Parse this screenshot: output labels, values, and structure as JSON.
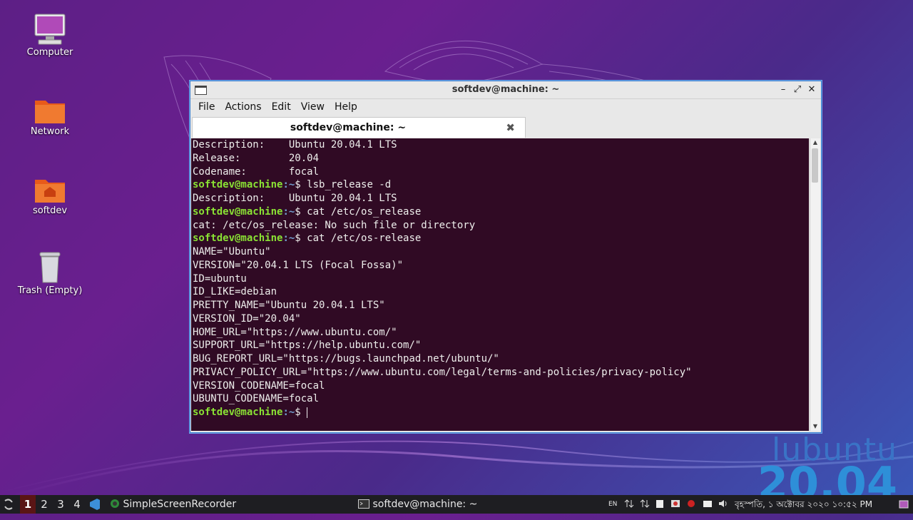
{
  "desktop": {
    "icons": [
      {
        "label": "Computer"
      },
      {
        "label": "Network"
      },
      {
        "label": "softdev"
      },
      {
        "label": "Trash (Empty)"
      }
    ],
    "brand": {
      "name": "lubuntu",
      "version": "20.04"
    }
  },
  "window": {
    "title": "softdev@machine: ~",
    "buttons": {
      "minimize": "–",
      "maximize": "⤢",
      "close": "✕"
    },
    "menu": [
      "File",
      "Actions",
      "Edit",
      "View",
      "Help"
    ],
    "tab": {
      "label": "softdev@machine: ~",
      "close": "✖"
    }
  },
  "terminal": {
    "prompt_user": "softdev@machine",
    "prompt_path": ":~",
    "prompt_symbol": "$ ",
    "lines": [
      {
        "type": "out",
        "text": "Description:    Ubuntu 20.04.1 LTS"
      },
      {
        "type": "out",
        "text": "Release:        20.04"
      },
      {
        "type": "out",
        "text": "Codename:       focal"
      },
      {
        "type": "cmd",
        "text": "lsb_release -d"
      },
      {
        "type": "out",
        "text": "Description:    Ubuntu 20.04.1 LTS"
      },
      {
        "type": "cmd",
        "text": "cat /etc/os_release"
      },
      {
        "type": "out",
        "text": "cat: /etc/os_release: No such file or directory"
      },
      {
        "type": "cmd",
        "text": "cat /etc/os-release"
      },
      {
        "type": "out",
        "text": "NAME=\"Ubuntu\""
      },
      {
        "type": "out",
        "text": "VERSION=\"20.04.1 LTS (Focal Fossa)\""
      },
      {
        "type": "out",
        "text": "ID=ubuntu"
      },
      {
        "type": "out",
        "text": "ID_LIKE=debian"
      },
      {
        "type": "out",
        "text": "PRETTY_NAME=\"Ubuntu 20.04.1 LTS\""
      },
      {
        "type": "out",
        "text": "VERSION_ID=\"20.04\""
      },
      {
        "type": "out",
        "text": "HOME_URL=\"https://www.ubuntu.com/\""
      },
      {
        "type": "out",
        "text": "SUPPORT_URL=\"https://help.ubuntu.com/\""
      },
      {
        "type": "out",
        "text": "BUG_REPORT_URL=\"https://bugs.launchpad.net/ubuntu/\""
      },
      {
        "type": "out",
        "text": "PRIVACY_POLICY_URL=\"https://www.ubuntu.com/legal/terms-and-policies/privacy-policy\""
      },
      {
        "type": "out",
        "text": "VERSION_CODENAME=focal"
      },
      {
        "type": "out",
        "text": "UBUNTU_CODENAME=focal"
      },
      {
        "type": "cmd",
        "text": "",
        "cursor": true
      }
    ]
  },
  "taskbar": {
    "workspaces": [
      "1",
      "2",
      "3",
      "4"
    ],
    "active_workspace": "1",
    "apps": [
      {
        "label": "SimpleScreenRecorder",
        "icon": "screen-recorder-icon"
      },
      {
        "label": "softdev@machine: ~",
        "icon": "terminal-icon"
      }
    ],
    "keyboard_layout": "EN",
    "clock": "বৃহস্পতি, ১ অক্টোবর ২০২০ ১০:৫২ PM"
  },
  "colors": {
    "terminal_bg": "#300a24",
    "prompt_user": "#8ae234",
    "prompt_path": "#729fcf",
    "window_border": "#3a7fd0",
    "active_workspace": "#5a1515"
  }
}
